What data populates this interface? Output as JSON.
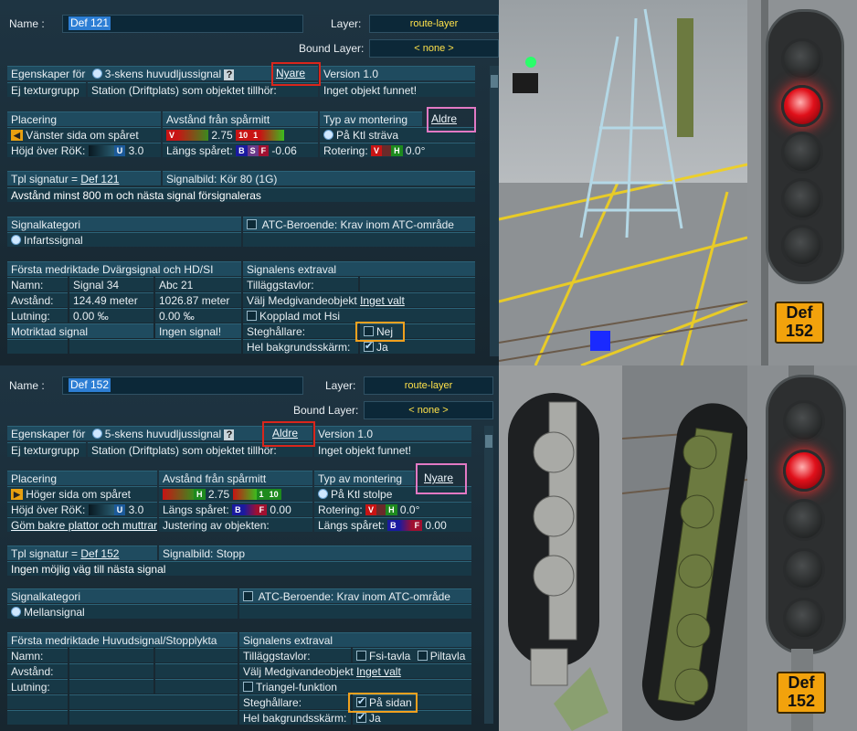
{
  "top": {
    "name_label": "Name :",
    "name_value": "Def 121",
    "layer_label": "Layer:",
    "layer_value": "route-layer",
    "bound_label": "Bound Layer:",
    "bound_value": "< none >",
    "egenskaper": "Egenskaper för",
    "signal_type": "3-skens huvudljussignal",
    "help": "?",
    "nav_link": "Nyare",
    "version": "Version 1.0",
    "ej_textur": "Ej texturgrupp",
    "station": "Station (Driftplats) som objektet tillhör:",
    "inget_objekt": "Inget objekt funnet!",
    "placering": "Placering",
    "avstand_header": "Avstånd från spårmitt",
    "typ_montering": "Typ av montering",
    "aldre_link": "Aldre",
    "side": "Vänster sida om spåret",
    "v_box": "V",
    "dist_value": "2.75",
    "ten_box": "10",
    "one_box": "1",
    "mount": "På Ktl sträva",
    "hojd": "Höjd över RöK:",
    "u_box": "U",
    "hojd_value": "3.0",
    "langs": "Längs spåret:",
    "b_box": "B",
    "s_box": "S",
    "f_box": "F",
    "langs_value": "-0.06",
    "rotering": "Rotering:",
    "rv_box": "V",
    "rh_box": "H",
    "rot_value": "0.0°",
    "tpl": "Tpl signatur =",
    "tpl_link": "Def 121",
    "signalbild": "Signalbild: Kör 80 (1G)",
    "message": "Avstånd minst 800 m och nästa signal försignaleras",
    "signalkategori": "Signalkategori",
    "atc": "ATC-Beroende:",
    "atc_krav": "Krav inom ATC-område",
    "kategori": "Infartssignal",
    "forsta": "Första medriktade Dvärgsignal och HD/SI",
    "extraval": "Signalens extraval",
    "namn": "Namn:",
    "namn1": "Signal 34",
    "namn2": "Abc 21",
    "tillagg": "Tilläggstavlor:",
    "avstand": "Avstånd:",
    "avst1": "124.49 meter",
    "avst2": "1026.87 meter",
    "valj": "Välj Medgivandeobjekt",
    "inget_valt": "Inget valt",
    "lutning": "Lutning:",
    "lut1": "0.00 ‰",
    "lut2": "0.00 ‰",
    "kopplad": "Kopplad mot Hsi",
    "motriktad": "Motriktad signal",
    "ingen_signal": "Ingen signal!",
    "steg": "Steghållare:",
    "steg_value": "Nej",
    "hel": "Hel bakgrundsskärm:",
    "hel_value": "Ja"
  },
  "bottom": {
    "name_label": "Name :",
    "name_value": "Def 152",
    "layer_label": "Layer:",
    "layer_value": "route-layer",
    "bound_label": "Bound Layer:",
    "bound_value": "< none >",
    "egenskaper": "Egenskaper för",
    "signal_type": "5-skens huvudljussignal",
    "help": "?",
    "nav_link": "Aldre",
    "version": "Version 1.0",
    "ej_textur": "Ej texturgrupp",
    "station": "Station (Driftplats) som objektet tillhör:",
    "inget_objekt": "Inget objekt funnet!",
    "placering": "Placering",
    "avstand_header": "Avstånd från spårmitt",
    "typ_montering": "Typ av montering",
    "nyare_link": "Nyare",
    "side": "Höger sida om spåret",
    "h_box": "H",
    "dist_value": "2.75",
    "one_box": "1",
    "ten_box": "10",
    "mount": "På Ktl stolpe",
    "hojd": "Höjd över RöK:",
    "u_box": "U",
    "hojd_value": "3.0",
    "langs": "Längs spåret:",
    "b_box": "B",
    "f_box": "F",
    "langs_value": "0.00",
    "rotering": "Rotering:",
    "rv_box": "V",
    "rh_box": "H",
    "rot_value": "0.0°",
    "gom": "Göm bakre plattor och muttrar:",
    "justering": "Justering av objekten:",
    "langs2": "Längs spåret:",
    "b2_box": "B",
    "f2_box": "F",
    "langs2_value": "0.00",
    "tpl": "Tpl signatur =",
    "tpl_link": "Def 152",
    "signalbild": "Signalbild: Stopp",
    "message": "Ingen möjlig väg till nästa signal",
    "signalkategori": "Signalkategori",
    "atc": "ATC-Beroende:",
    "atc_krav": "Krav inom ATC-område",
    "kategori": "Mellansignal",
    "forsta": "Första medriktade Huvudsignal/Stopplykta",
    "extraval": "Signalens extraval",
    "namn": "Namn:",
    "tillagg": "Tilläggstavlor:",
    "fsi": "Fsi-tavla",
    "pil": "Piltavla",
    "avstand": "Avstånd:",
    "valj": "Välj Medgivandeobjekt",
    "inget_valt": "Inget valt",
    "lutning": "Lutning:",
    "triangel": "Triangel-funktion",
    "steg": "Steghållare:",
    "steg_value": "På sidan",
    "hel": "Hel bakgrundsskärm:",
    "hel_value": "Ja"
  },
  "plates": {
    "top_line1": "Def",
    "top_line2": "152",
    "bot_line1": "Def",
    "bot_line2": "152"
  },
  "colors": {
    "highlight_red": "#d9261c",
    "highlight_pink": "#e279c4",
    "highlight_orange": "#f0a01e",
    "layer_text": "#ffe24a",
    "signal_red": "#e0101a",
    "plate_orange": "#f2a20c"
  }
}
